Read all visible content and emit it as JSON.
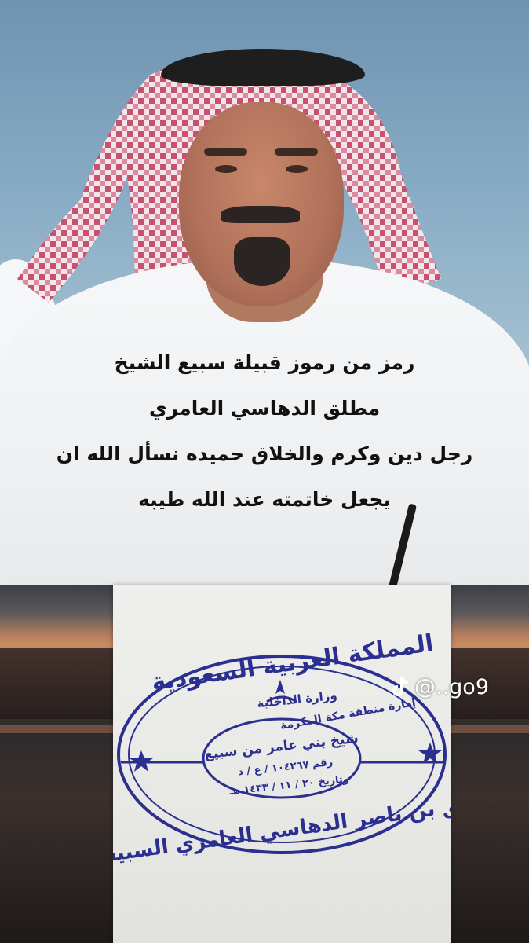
{
  "caption": {
    "line1": "رمز من رموز قبيلة سبيع الشيخ",
    "line2": "مطلق الدهاسي العامري",
    "line3": "رجل دين وكرم والخلاق حميده نسأل الله ان",
    "line4": "يجعل خاتمته عند الله طيبه"
  },
  "watermark": {
    "handle": "@..go9",
    "icon": "tiktok-icon"
  },
  "stamp": {
    "outer_top": "المملكة العربية السعودية",
    "ministry": "وزارة الداخلية",
    "emirate": "إمارة منطقة مكة المكرمة",
    "center": "شيخ بني عامر من سبيع",
    "number": "رقم ١٠٤٢٦٧ / ع / د",
    "date": "وتاريخ ٢٠ / ١١ / ١٤٣٣ هـ",
    "outer_bottom": "مطلق بن ناصر الدهاسي العامري السبيعي",
    "ink_color": "#2b2f8f"
  }
}
